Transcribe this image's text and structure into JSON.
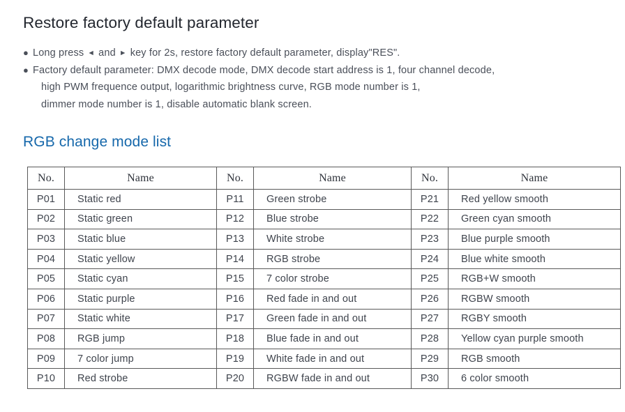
{
  "section1": {
    "title": "Restore factory default parameter",
    "bullets": [
      {
        "dot": "●",
        "lines": [
          {
            "parts": [
              {
                "type": "text",
                "value": "Long press "
              },
              {
                "type": "glyph",
                "value": "◄"
              },
              {
                "type": "text",
                "value": " and "
              },
              {
                "type": "glyph",
                "value": "►"
              },
              {
                "type": "text",
                "value": " key for 2s, restore factory default parameter, display\"RES\"."
              }
            ]
          }
        ]
      },
      {
        "dot": "●",
        "lines": [
          {
            "text": "Factory default parameter: DMX decode mode, DMX decode start address is 1, four channel decode,"
          },
          {
            "text": "high PWM frequence output, logarithmic brightness curve, RGB mode number is 1,"
          },
          {
            "text": "dimmer mode number is 1, disable automatic blank screen."
          }
        ]
      }
    ]
  },
  "section2": {
    "title": "RGB change mode list",
    "title_color": "#1668ab",
    "table": {
      "headers": [
        "No.",
        "Name",
        "No.",
        "Name",
        "No.",
        "Name"
      ],
      "rows": [
        [
          "P01",
          "Static red",
          "P11",
          "Green strobe",
          "P21",
          "Red yellow smooth"
        ],
        [
          "P02",
          "Static green",
          "P12",
          "Blue strobe",
          "P22",
          "Green cyan smooth"
        ],
        [
          "P03",
          "Static blue",
          "P13",
          "White strobe",
          "P23",
          "Blue purple smooth"
        ],
        [
          "P04",
          "Static yellow",
          "P14",
          "RGB strobe",
          "P24",
          "Blue white smooth"
        ],
        [
          "P05",
          "Static cyan",
          "P15",
          "7 color strobe",
          "P25",
          "RGB+W smooth"
        ],
        [
          "P06",
          "Static purple",
          "P16",
          "Red fade in and out",
          "P26",
          "RGBW smooth"
        ],
        [
          "P07",
          "Static white",
          "P17",
          "Green fade in and out",
          "P27",
          "RGBY smooth"
        ],
        [
          "P08",
          "RGB jump",
          "P18",
          "Blue fade in and out",
          "P28",
          "Yellow cyan purple smooth"
        ],
        [
          "P09",
          "7 color jump",
          "P19",
          "White fade in and out",
          "P29",
          "RGB smooth"
        ],
        [
          "P10",
          "Red strobe",
          "P20",
          "RGBW fade in and out",
          "P30",
          "6 color smooth"
        ]
      ]
    }
  }
}
